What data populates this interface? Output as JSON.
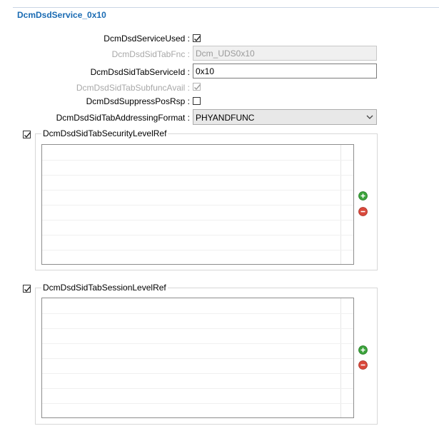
{
  "section": {
    "title": "DcmDsdService_0x10"
  },
  "fields": {
    "service_used": {
      "label": "DcmDsdServiceUsed :",
      "checked": true
    },
    "sid_tab_fnc": {
      "label": "DcmDsdSidTabFnc :",
      "value": "Dcm_UDS0x10"
    },
    "sid_tab_service_id": {
      "label": "DcmDsdSidTabServiceId :",
      "value": "0x10"
    },
    "subfunc_avail": {
      "label": "DcmDsdSidTabSubfuncAvail :",
      "checked": true
    },
    "suppress_pos_rsp": {
      "label": "DcmDsdSuppressPosRsp :",
      "checked": false
    },
    "addressing_format": {
      "label": "DcmDsdSidTabAddressingFormat :",
      "value": "PHYANDFUNC"
    }
  },
  "security_group": {
    "title": "DcmDsdSidTabSecurityLevelRef",
    "checked": true,
    "rows": []
  },
  "session_group": {
    "title": "DcmDsdSidTabSessionLevelRef",
    "checked": true,
    "rows": []
  },
  "icons": {
    "add": "add-icon",
    "remove": "remove-icon",
    "dropdown": "chevron-down-icon",
    "check": "check-icon"
  },
  "colors": {
    "title": "#1a6bb3",
    "add": "#3aa23a",
    "remove": "#d9483b"
  }
}
